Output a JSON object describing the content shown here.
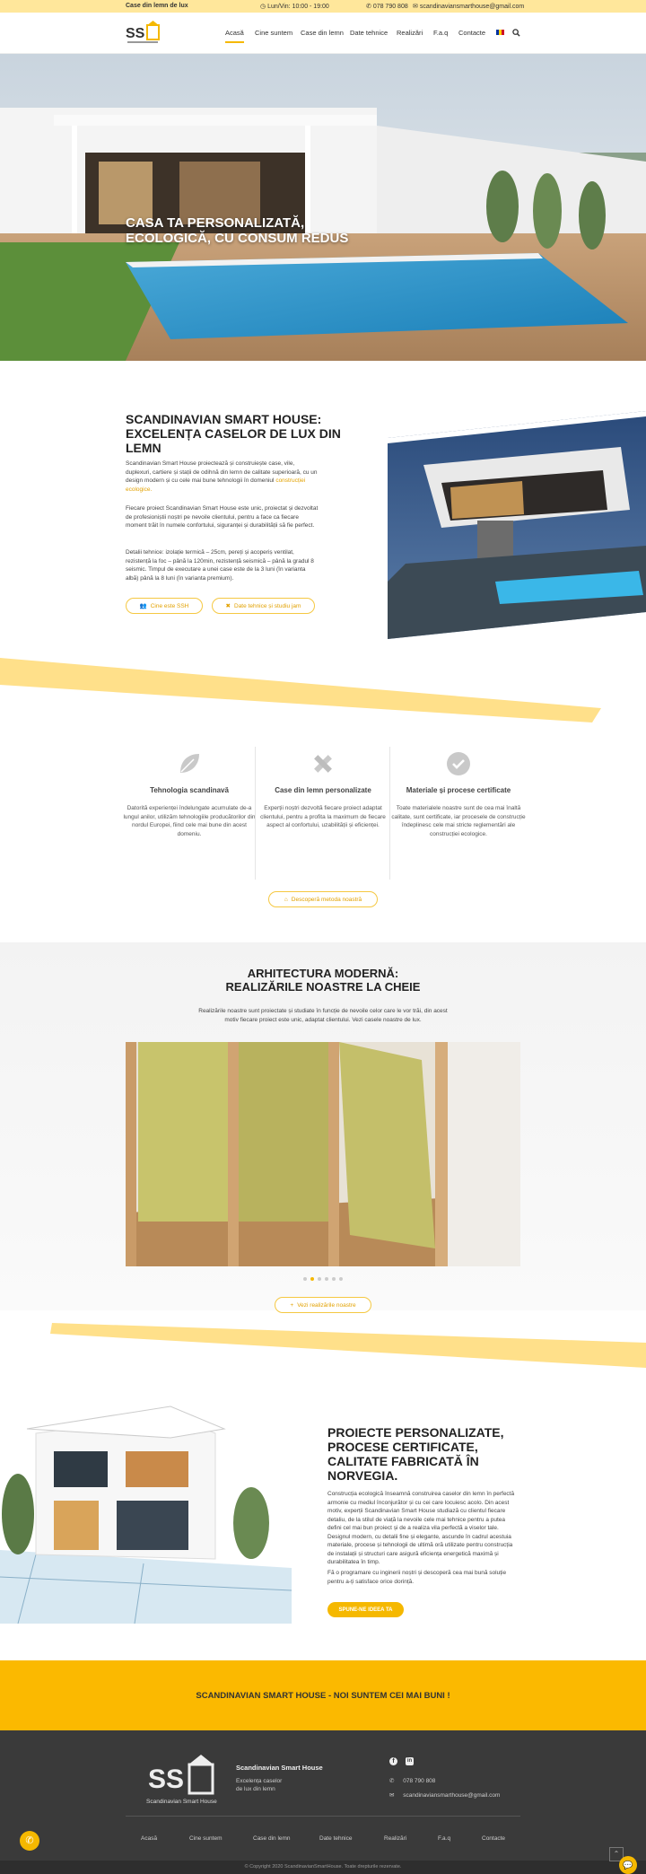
{
  "topbar": {
    "tagline": "Case din lemn de lux",
    "hours": "Lun/Vin: 10:00 - 19:00",
    "phone": "078 790 808",
    "email": "scandinaviansmarthouse@gmail.com"
  },
  "nav": {
    "items": [
      "Acasă",
      "Cine suntem",
      "Case din lemn",
      "Date tehnice",
      "Realizări",
      "F.a.q",
      "Contacte"
    ]
  },
  "hero": {
    "title": "CASA TA PERSONALIZATĂ, ECOLOGICĂ, CU CONSUM REDUS"
  },
  "about": {
    "title": "SCANDINAVIAN SMART HOUSE: EXCELENȚA CASELOR DE LUX DIN LEMN",
    "p1": "Scandinavian Smart House proiectează și construiește case, vile, duplexuri, cartiere și stații de odihnă din lemn de calitate superioară, cu un design modern și cu cele mai bune tehnologii în domeniul",
    "p1_link": "construcției ecologice.",
    "p2": "Fiecare proiect Scandinavian Smart House este unic, proiectat și dezvoltat de profesioniștii noștri pe nevoile clientului, pentru a face ca fiecare moment trăit în numele confortului, siguranței și durabilității să fie perfect.",
    "p3": "Detalii tehnice: izolație termică – 25cm, pereți și acoperiș ventilat, rezistență la foc – până la 120min, rezistență seismică – până la gradul 8 seismic. Timpul de executare a unei case este de la 3 luni (în varianta albă) până la 8 luni (în varianta premium).",
    "btn1": "Cine este SSH",
    "btn2": "Date tehnice și studiu jam"
  },
  "features": [
    {
      "title": "Tehnologia scandinavă",
      "text": "Datorită experienței îndelungate acumulate de-a lungul anilor, utilizăm tehnologiile producătorilor din nordul Europei, fiind cele mai bune din acest domeniu."
    },
    {
      "title": "Case din lemn personalizate",
      "text": "Experții noștri dezvoltă fiecare proiect adaptat clientului, pentru a profita la maximum de fiecare aspect al confortului, uzabilității și eficienței."
    },
    {
      "title": "Materiale și procese certificate",
      "text": "Toate materialele noastre sunt de cea mai înaltă calitate, sunt certificate, iar procesele de construcție îndeplinesc cele mai stricte reglementări ale construcției ecologice."
    }
  ],
  "features_btn": "Descoperă metoda noastră",
  "realizari": {
    "title_l1": "ARHITECTURA MODERNĂ:",
    "title_l2": "REALIZĂRILE NOASTRE LA CHEIE",
    "text": "Realizările noastre sunt proiectate și studiate în funcție de nevoile celor care le vor trăi, din acest motiv fiecare proiect este unic, adaptat clientului. Vezi casele noastre de lux.",
    "btn": "Vezi realizările noastre"
  },
  "proiecte": {
    "title": "PROIECTE PERSONALIZATE, PROCESE CERTIFICATE, CALITATE FABRICATĂ ÎN NORVEGIA.",
    "text": "Construcția ecologică înseamnă construirea caselor din lemn în perfectă armonie cu mediul înconjurător și cu cei care locuiesc acolo. Din acest motiv, experții Scandinavian Smart House studiază cu clientul fiecare detaliu, de la stilul de viață la nevoile cele mai tehnice pentru a putea defini cel mai bun proiect și de a realiza vila perfectă a viselor tale. Designul modern, cu detalii fine și elegante, ascunde în cadrul acestuia materiale, procese și tehnologii de ultimă oră utilizate pentru construcția de instalații și structuri care asigură eficiența energetică maximă și durabilitatea în timp.",
    "text2": "Fă o programare cu inginerii noștri și descoperă cea mai bună soluție pentru a-ți satisface orice dorință.",
    "btn": "SPUNE-NE IDEEA TA"
  },
  "banner": "SCANDINAVIAN SMART HOUSE - NOI SUNTEM CEI MAI BUNI !",
  "footer": {
    "logo_text": "Scandinavian Smart House",
    "title": "Scandinavian Smart House",
    "desc_l1": "Excelența caselor",
    "desc_l2": "de lux din lemn",
    "phone": "078 790 808",
    "email": "scandinaviansmarthouse@gmail.com",
    "nav": [
      "Acasă",
      "Cine suntem",
      "Case din lemn",
      "Date tehnice",
      "Realizări",
      "F.a.q",
      "Contacte"
    ],
    "copyright": "© Copyright 2020 ScandinavianSmartHouse. Toate drepturile rezervate."
  },
  "colors": {
    "accent": "#f5b800",
    "light_yellow": "#ffe79b",
    "footer_bg": "#3a3a3a"
  }
}
